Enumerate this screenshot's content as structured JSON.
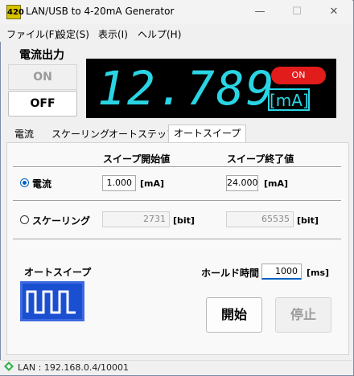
{
  "window": {
    "title": "LAN/USB to 4-20mA Generator",
    "icon_text": "420",
    "minimize": "—",
    "maximize": "☐",
    "close": "✕"
  },
  "menu": [
    "ファイル(F)",
    "設定(S)",
    "表示(I)",
    "ヘルプ(H)"
  ],
  "output": {
    "title": "電流出力",
    "on_label": "ON",
    "off_label": "OFF",
    "display_value": "12.789",
    "state_badge": "ON",
    "unit": "[mA]",
    "accent_color": "#29d5e4",
    "badge_color": "#e21b1b"
  },
  "tabs": [
    "電流",
    "スケーリング",
    "オートステップ",
    "オートスイープ"
  ],
  "active_tab": "オートスイープ",
  "sweep": {
    "start_header": "スイープ開始値",
    "end_header": "スイープ終了値",
    "current": {
      "label": "電流",
      "selected": true,
      "start_value": "1.000",
      "end_value": "24.000",
      "unit": "[mA]"
    },
    "scaling": {
      "label": "スケーリング",
      "selected": false,
      "start_value": "2731",
      "end_value": "65535",
      "unit": "[bit]"
    },
    "auto_sweep_label": "オートスイープ",
    "hold_label": "ホールド時間",
    "hold_value": "1000",
    "hold_unit": "[ms]",
    "start_button": "開始",
    "stop_button": "停止"
  },
  "statusbar": {
    "text": "LAN : 192.168.0.4/10001"
  }
}
